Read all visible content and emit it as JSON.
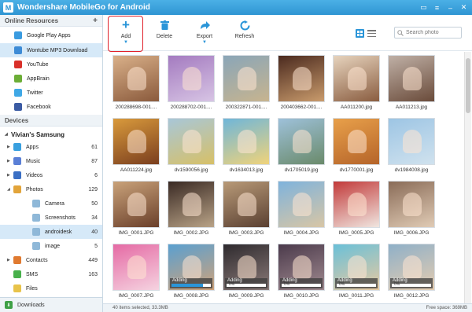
{
  "app": {
    "title": "Wondershare MobileGo for Android",
    "logo_letter": "M"
  },
  "sidebar": {
    "online_header": "Online Resources",
    "online_add": "+",
    "online_items": [
      {
        "label": "Google Play Apps",
        "icon": "google-play-icon",
        "color": "#3a9be0"
      },
      {
        "label": "Wontube MP3 Download",
        "icon": "wontube-icon",
        "color": "#3d8bd6"
      },
      {
        "label": "YouTube",
        "icon": "youtube-icon",
        "color": "#d9302a"
      },
      {
        "label": "AppBrain",
        "icon": "appbrain-icon",
        "color": "#6cae37"
      },
      {
        "label": "Twitter",
        "icon": "twitter-icon",
        "color": "#3fa8e6"
      },
      {
        "label": "Facebook",
        "icon": "facebook-icon",
        "color": "#3b5ba3"
      }
    ],
    "devices_header": "Devices",
    "device_name": "Vivian's Samsung",
    "device_items": [
      {
        "label": "Apps",
        "count": "61",
        "color": "#39a0df"
      },
      {
        "label": "Music",
        "count": "87",
        "color": "#5a7fd6"
      },
      {
        "label": "Videos",
        "count": "6",
        "color": "#3a6fc4"
      },
      {
        "label": "Photos",
        "count": "129",
        "color": "#e2a43a"
      },
      {
        "label": "Camera",
        "count": "50",
        "color": "#8fb8d8"
      },
      {
        "label": "Screenshots",
        "count": "34",
        "color": "#8fb8d8"
      },
      {
        "label": "androidesk",
        "count": "40",
        "color": "#8fb8d8"
      },
      {
        "label": "image",
        "count": "5",
        "color": "#8fb8d8"
      },
      {
        "label": "Contacts",
        "count": "449",
        "color": "#e07a30"
      },
      {
        "label": "SMS",
        "count": "163",
        "color": "#48b04b"
      },
      {
        "label": "Files",
        "count": "",
        "color": "#e8c34a"
      }
    ],
    "downloads_label": "Downloads"
  },
  "toolbar": {
    "add": "Add",
    "delete": "Delete",
    "export": "Export",
    "refresh": "Refresh",
    "search_placeholder": "Search photo"
  },
  "photos": [
    {
      "name": "200288698-001....",
      "colors": [
        "#d9b089",
        "#8a5a3c"
      ],
      "adding": null
    },
    {
      "name": "200288702-001....",
      "colors": [
        "#a47bc0",
        "#d7c4e4"
      ],
      "adding": null
    },
    {
      "name": "200322871-001....",
      "colors": [
        "#8aa6b8",
        "#c7b48f"
      ],
      "adding": null
    },
    {
      "name": "200403662-001....",
      "colors": [
        "#4b2a1f",
        "#c99b6c"
      ],
      "adding": null
    },
    {
      "name": "AA011200.jpg",
      "colors": [
        "#e6d3bd",
        "#8a5d40"
      ],
      "adding": null
    },
    {
      "name": "AA011213.jpg",
      "colors": [
        "#bfb0a6",
        "#6a4b3a"
      ],
      "adding": null
    },
    {
      "name": "AA011224.jpg",
      "colors": [
        "#d99a3c",
        "#7a3e1e"
      ],
      "adding": null
    },
    {
      "name": "dv1590056.jpg",
      "colors": [
        "#a8c7d8",
        "#d7c067"
      ],
      "adding": null
    },
    {
      "name": "dv1634013.jpg",
      "colors": [
        "#6fb6d9",
        "#f0d37a"
      ],
      "adding": null
    },
    {
      "name": "dv1705019.jpg",
      "colors": [
        "#9ec1da",
        "#6a8a6a"
      ],
      "adding": null
    },
    {
      "name": "dv1770001.jpg",
      "colors": [
        "#e8a04a",
        "#b5642a"
      ],
      "adding": null
    },
    {
      "name": "dv1984008.jpg",
      "colors": [
        "#9dc5e4",
        "#d0e2ee"
      ],
      "adding": null
    },
    {
      "name": "IMG_0001.JPG",
      "colors": [
        "#c9a27a",
        "#6a3f2a"
      ],
      "adding": null
    },
    {
      "name": "IMG_0002.JPG",
      "colors": [
        "#3a2a24",
        "#b9a387"
      ],
      "adding": null
    },
    {
      "name": "IMG_0003.JPG",
      "colors": [
        "#b89a78",
        "#5a4032"
      ],
      "adding": null
    },
    {
      "name": "IMG_0004.JPG",
      "colors": [
        "#7fb3dc",
        "#d8c6a5"
      ],
      "adding": null
    },
    {
      "name": "IMG_0005.JPG",
      "colors": [
        "#c23a3a",
        "#f0e6e0"
      ],
      "adding": null
    },
    {
      "name": "IMG_0006.JPG",
      "colors": [
        "#8a6c58",
        "#e0cbb5"
      ],
      "adding": null
    },
    {
      "name": "IMG_0007.JPG",
      "colors": [
        "#e56aa4",
        "#f5d3e0"
      ],
      "adding": null
    },
    {
      "name": "IMG_0008.JPG",
      "colors": [
        "#5aa0d0",
        "#cfa27a"
      ],
      "adding": {
        "label": "Adding",
        "pct": "",
        "progress": 0.8
      }
    },
    {
      "name": "IMG_0009.JPG",
      "colors": [
        "#2e2a2e",
        "#8a7a78"
      ],
      "adding": {
        "label": "Adding",
        "pct": "0%",
        "progress": 0
      }
    },
    {
      "name": "IMG_0010.JPG",
      "colors": [
        "#4b3a4b",
        "#a08a90"
      ],
      "adding": {
        "label": "Adding",
        "pct": "0%",
        "progress": 0
      }
    },
    {
      "name": "IMG_0011.JPG",
      "colors": [
        "#6ac0d8",
        "#e8c9a0"
      ],
      "adding": {
        "label": "Adding",
        "pct": "0%",
        "progress": 0
      }
    },
    {
      "name": "IMG_0012.JPG",
      "colors": [
        "#8fb0c8",
        "#e4ccb0"
      ],
      "adding": {
        "label": "Adding",
        "pct": "0%",
        "progress": 0
      }
    }
  ],
  "status": {
    "selected": "40 items selected, 33.3MB",
    "free_space": "Free space: 369MB"
  }
}
